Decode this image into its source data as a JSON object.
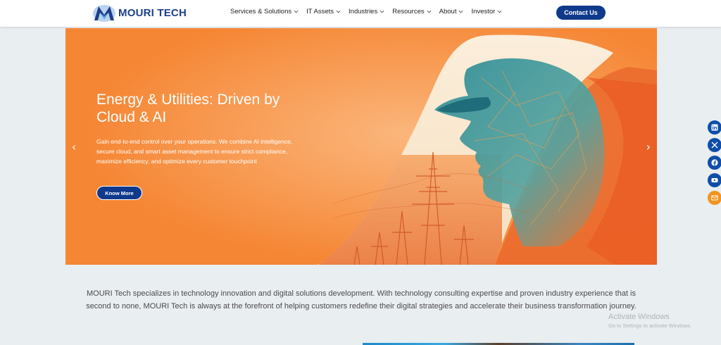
{
  "header": {
    "logo_text": "MOURI TECH",
    "nav": [
      {
        "label": "Services & Solutions"
      },
      {
        "label": "IT Assets"
      },
      {
        "label": "Industries"
      },
      {
        "label": "Resources"
      },
      {
        "label": "About"
      },
      {
        "label": "Investor"
      }
    ],
    "contact_label": "Contact Us"
  },
  "hero": {
    "title": "Energy & Utilities: Driven by Cloud & AI",
    "description": "Gain end-to-end control over your operations. We combine AI intelligence, secure cloud, and smart asset management to ensure strict compliance, maximize efficiency, and optimize every customer touchpoint",
    "cta_label": "Know More",
    "prev_arrow": "‹",
    "next_arrow": "›"
  },
  "intro": {
    "text": "MOURI Tech specializes in technology innovation and digital solutions development. With technology consulting expertise and proven industry experience that is second to none, MOURI Tech is always at the forefront of helping customers redefine their digital strategies and accelerate their business transformation journey."
  },
  "social": [
    "linkedin-icon",
    "x-twitter-icon",
    "facebook-icon",
    "youtube-icon",
    "mail-icon"
  ],
  "watermark": {
    "title": "Activate Windows",
    "subtitle": "Go to Settings to activate Windows."
  },
  "colors": {
    "brand_blue": "#0f3a8c",
    "hero_orange": "#f58634",
    "social_blue": "#0f4ea8",
    "mail_orange": "#f0951f"
  }
}
